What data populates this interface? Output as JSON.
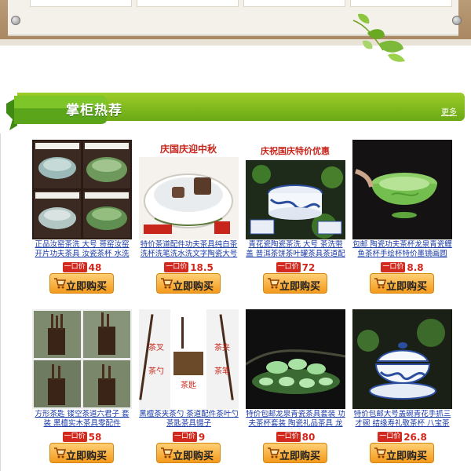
{
  "header": {
    "title": "掌柜热荐",
    "more_label": "更多"
  },
  "products": [
    {
      "title": "正品汝窑茶洗 大号 哥窑汝窑开片功夫茶具 汝瓷茶杯 水洗",
      "price_badge": "一口价",
      "price": "48",
      "buy_label": "立即购买",
      "icon": "tea-washer-bowls"
    },
    {
      "title": "特价茶道配件功夫茶具纯白茶洗杯洗笔洗水洗文字陶瓷大号",
      "price_badge": "一口价",
      "price": "18.5",
      "buy_label": "立即购买",
      "icon": "white-tea-washer",
      "promo_text": "庆国庆迎中秋"
    },
    {
      "title": "青花瓷陶瓷茶洗 大号 茶洗带盖 普洱茶饼茶叶罐茶具茶道配",
      "price_badge": "一口价",
      "price": "72",
      "buy_label": "立即购买",
      "icon": "blue-white-tea-jar",
      "promo_text": "庆祝国庆特价优惠"
    },
    {
      "title": "包邮 陶瓷功夫茶杯龙泉青瓷鲤鱼茶杯手绘杯特价墨镜画圆",
      "price_badge": "一口价",
      "price": "8.8",
      "buy_label": "立即购买",
      "icon": "celadon-fish-cup"
    },
    {
      "title": "方形茶匙 镂空茶道六君子 套装 黑檀实木茶具零配件",
      "price_badge": "一口价",
      "price": "58",
      "buy_label": "立即购买",
      "icon": "tea-utensil-set"
    },
    {
      "title": "黑檀茶夹茶勺 茶道配件茶叶勺 茶匙茶具镊子",
      "price_badge": "一口价",
      "price": "9",
      "buy_label": "立即购买",
      "icon": "ebony-tea-tools",
      "tool_labels": [
        "茶叉",
        "茶夹",
        "茶勺",
        "茶笔",
        "茶匙"
      ]
    },
    {
      "title": "特价包邮龙泉青瓷茶具套装 功夫茶杯套装 陶瓷礼品茶具 龙泉青",
      "price_badge": "一口价",
      "price": "80",
      "buy_label": "立即购买",
      "icon": "celadon-tea-set"
    },
    {
      "title": "特价包邮大号盖碗青花手抓三才碗 结缘寿礼敬茶杯 八宝茶",
      "price_badge": "一口价",
      "price": "26.8",
      "buy_label": "立即购买",
      "icon": "blue-white-gaiwan"
    }
  ],
  "colors": {
    "header_green": "#7ebf1c",
    "price_red": "#d2261c",
    "buy_orange": "#f29a1c",
    "link_blue": "#1a3aa8"
  }
}
